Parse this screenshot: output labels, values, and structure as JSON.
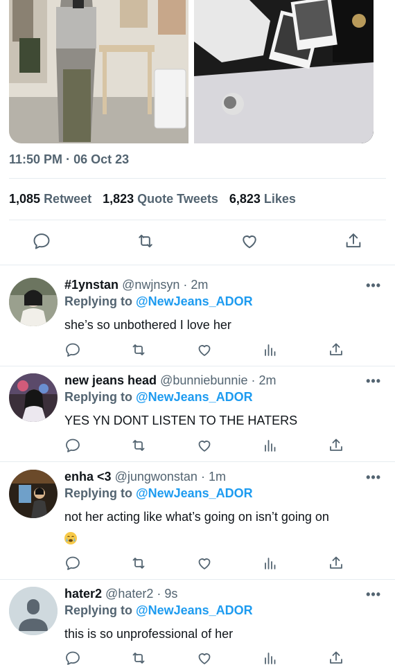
{
  "tweet": {
    "time": "11:50 PM",
    "date": "06 Oct 23",
    "retweets": "1,085",
    "retweets_label": "Retweet",
    "quotes": "1,823",
    "quotes_label": "Quote Tweets",
    "likes": "6,823",
    "likes_label": "Likes"
  },
  "replies": [
    {
      "name": "#1ynstan",
      "handle": "@nwjnsyn",
      "time": "2m",
      "replying_to": "Replying to",
      "mention": "@NewJeans_ADOR",
      "text": "she’s so unbothered I love her"
    },
    {
      "name": "new jeans head",
      "handle": "@bunniebunnie",
      "time": "2m",
      "replying_to": "Replying to",
      "mention": "@NewJeans_ADOR",
      "text": "YES YN DONT LISTEN TO THE HATERS"
    },
    {
      "name": "enha <3",
      "handle": "@jungwonstan",
      "time": "1m",
      "replying_to": "Replying to",
      "mention": "@NewJeans_ADOR",
      "text": "not her acting like what’s going on isn’t going on"
    },
    {
      "name": "hater2",
      "handle": "@hater2",
      "time": "9s",
      "replying_to": "Replying to",
      "mention": "@NewJeans_ADOR",
      "text": "this is so unprofessional of her"
    }
  ],
  "ui": {
    "separator": "·",
    "more": "•••"
  },
  "colors": {
    "accent": "#1d9bf0",
    "secondary_text": "#536471",
    "divider": "#e6ecf0"
  },
  "icons": [
    "reply-icon",
    "retweet-icon",
    "like-icon",
    "share-icon",
    "analytics-icon",
    "more-icon",
    "emoji-crying-icon",
    "default-avatar-icon"
  ]
}
